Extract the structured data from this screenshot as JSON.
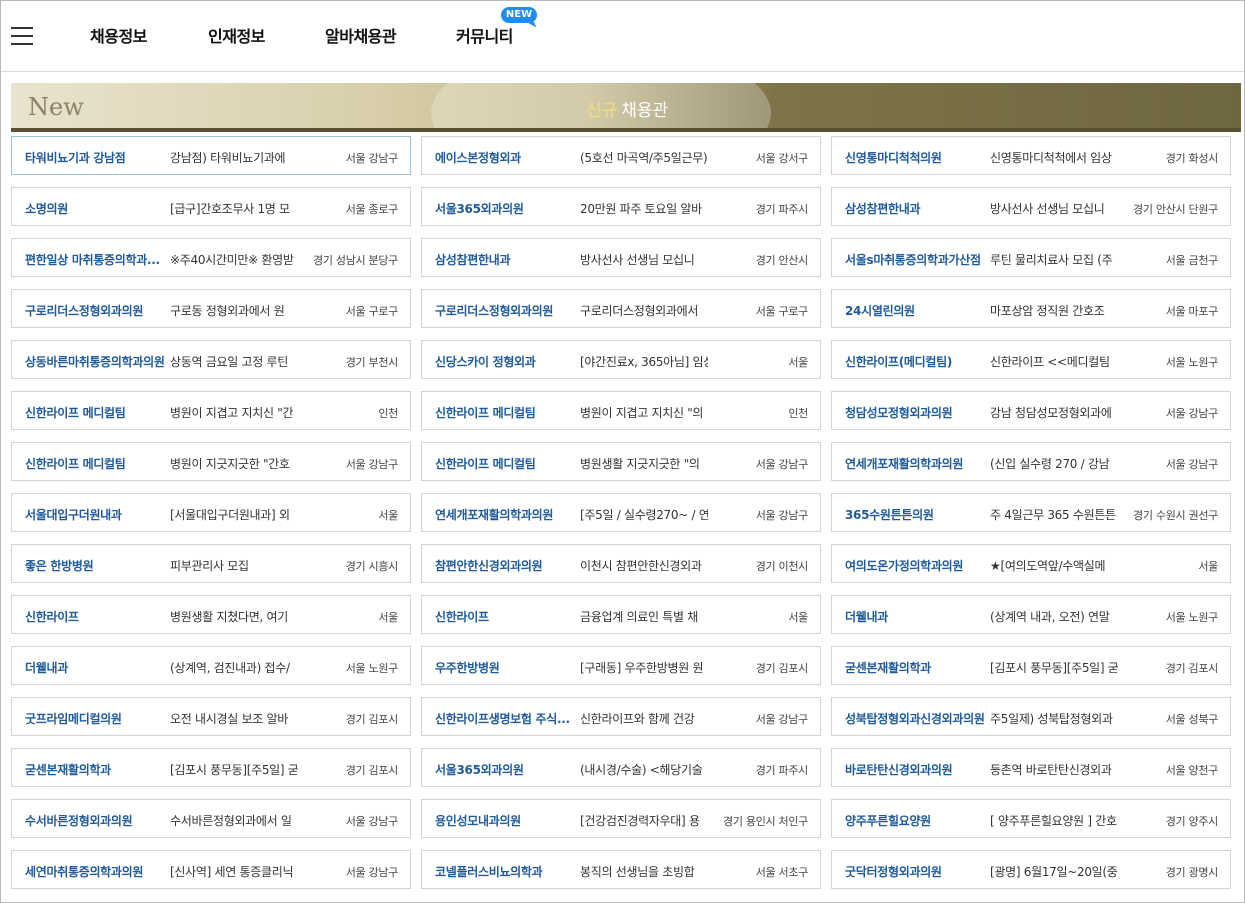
{
  "nav": {
    "items": [
      "채용정보",
      "인재정보",
      "알바채용관",
      "커뮤니티"
    ],
    "badge": "NEW"
  },
  "banner": {
    "new_label": "New",
    "highlight": "신규",
    "title": "채용관"
  },
  "jobs": [
    [
      {
        "name": "타워비뇨기과 강남점",
        "desc": "강남점) 타워비뇨기과에",
        "loc": "서울 강남구"
      },
      {
        "name": "에이스본정형외과",
        "desc": "(5호선 마곡역/주5일근무)",
        "loc": "서울 강서구"
      },
      {
        "name": "신영통마디척척의원",
        "desc": "신영통마디척척에서 임상",
        "loc": "경기 화성시"
      }
    ],
    [
      {
        "name": "소명의원",
        "desc": "[급구]간호조무사 1명 모",
        "loc": "서울 종로구"
      },
      {
        "name": "서울365외과의원",
        "desc": "20만원 파주 토요일 알바",
        "loc": "경기 파주시"
      },
      {
        "name": "삼성참편한내과",
        "desc": "방사선사 선생님 모십니",
        "loc": "경기 안산시 단원구"
      }
    ],
    [
      {
        "name": "편한일상 마취통증의학과...",
        "desc": "※주40시간미만※ 환영받",
        "loc": "경기 성남시 분당구"
      },
      {
        "name": "삼성참편한내과",
        "desc": "방사선사 선생님 모십니",
        "loc": "경기 안산시"
      },
      {
        "name": "서울s마취통증의학과가산점",
        "desc": "루틴 물리치료사 모집 (주",
        "loc": "서울 금천구"
      }
    ],
    [
      {
        "name": "구로리더스정형외과의원",
        "desc": "구로동 정형외과에서 원",
        "loc": "서울 구로구"
      },
      {
        "name": "구로리더스정형외과의원",
        "desc": "구로리더스정형외과에서",
        "loc": "서울 구로구"
      },
      {
        "name": "24시열린의원",
        "desc": "마포상암 정직원 간호조",
        "loc": "서울 마포구"
      }
    ],
    [
      {
        "name": "상동바른마취통증의학과의원",
        "desc": "상동역 금요일 고정 루틴",
        "loc": "경기 부천시"
      },
      {
        "name": "신당스카이 정형외과",
        "desc": "[야간진료x, 365아님] 임상",
        "loc": "서울"
      },
      {
        "name": "신한라이프(메디컬팀)",
        "desc": "신한라이프 <<메디컬팀",
        "loc": "서울 노원구"
      }
    ],
    [
      {
        "name": "신한라이프 메디컬팀",
        "desc": "병원이 지겹고 지치신 \"간",
        "loc": "인천"
      },
      {
        "name": "신한라이프 메디컬팀",
        "desc": "병원이 지겹고 지치신 \"의",
        "loc": "인천"
      },
      {
        "name": "청담성모정형외과의원",
        "desc": "강남 청담성모정형외과에",
        "loc": "서울 강남구"
      }
    ],
    [
      {
        "name": "신한라이프 메디컬팀",
        "desc": "병원이 지긋지긋한 \"간호",
        "loc": "서울 강남구"
      },
      {
        "name": "신한라이프 메디컬팀",
        "desc": "병원생활 지긋지긋한 \"의",
        "loc": "서울 강남구"
      },
      {
        "name": "연세개포재활의학과의원",
        "desc": "(신입 실수령 270 / 강남",
        "loc": "서울 강남구"
      }
    ],
    [
      {
        "name": "서울대입구더원내과",
        "desc": "[서울대입구더원내과] 외",
        "loc": "서울"
      },
      {
        "name": "연세개포재활의학과의원",
        "desc": "[주5일 / 실수령270~ / 연",
        "loc": "서울 강남구"
      },
      {
        "name": "365수원튼튼의원",
        "desc": "주 4일근무 365 수원튼튼",
        "loc": "경기 수원시 권선구"
      }
    ],
    [
      {
        "name": "좋은 한방병원",
        "desc": "피부관리사 모집",
        "loc": "경기 시흥시"
      },
      {
        "name": "참편안한신경외과의원",
        "desc": "이천시 참편안한신경외과",
        "loc": "경기 이천시"
      },
      {
        "name": "여의도온가정의학과의원",
        "desc": "★[여의도역앞/수액실메",
        "loc": "서울"
      }
    ],
    [
      {
        "name": "신한라이프",
        "desc": "병원생활 지쳤다면, 여기",
        "loc": "서울"
      },
      {
        "name": "신한라이프",
        "desc": "금융업계 의료인 특별 채",
        "loc": "서울"
      },
      {
        "name": "더웰내과",
        "desc": "(상계역 내과, 오전) 연말",
        "loc": "서울 노원구"
      }
    ],
    [
      {
        "name": "더웰내과",
        "desc": "(상계역, 검진내과) 접수/",
        "loc": "서울 노원구"
      },
      {
        "name": "우주한방병원",
        "desc": "[구래동] 우주한방병원 원",
        "loc": "경기 김포시"
      },
      {
        "name": "굳센본재활의학과",
        "desc": "[김포시 풍무동][주5일] 굳",
        "loc": "경기 김포시"
      }
    ],
    [
      {
        "name": "굿프라임메디컬의원",
        "desc": "오전 내시경실 보조 알바",
        "loc": "경기 김포시"
      },
      {
        "name": "신한라이프생명보험 주식...",
        "desc": "신한라이프와 함께 건강",
        "loc": "서울 강남구"
      },
      {
        "name": "성북탑정형외과신경외과의원",
        "desc": "주5일제) 성북탑정형외과",
        "loc": "서울 성북구"
      }
    ],
    [
      {
        "name": "굳센본재활의학과",
        "desc": "[김포시 풍무동][주5일] 굳",
        "loc": "경기 김포시"
      },
      {
        "name": "서울365외과의원",
        "desc": "(내시경/수술) <해당기술",
        "loc": "경기 파주시"
      },
      {
        "name": "바로탄탄신경외과의원",
        "desc": "등촌역 바로탄탄신경외과",
        "loc": "서울 양천구"
      }
    ],
    [
      {
        "name": "수서바른정형외과의원",
        "desc": "수서바른정형외과에서 일",
        "loc": "서울 강남구"
      },
      {
        "name": "용인성모내과의원",
        "desc": "[건강검진경력자우대] 용",
        "loc": "경기 용인시 처인구"
      },
      {
        "name": "양주푸른힐요양원",
        "desc": "[ 양주푸른힐요양원 ] 간호",
        "loc": "경기 양주시"
      }
    ],
    [
      {
        "name": "세연마취통증의학과의원",
        "desc": "[신사역] 세연 통증클리닉",
        "loc": "서울 강남구"
      },
      {
        "name": "코넬플러스비뇨의학과",
        "desc": "봉직의 선생님을 초빙합",
        "loc": "서울 서초구"
      },
      {
        "name": "굿닥터정형외과의원",
        "desc": "[광명] 6월17일~20일(중 4",
        "loc": "경기 광명시"
      }
    ]
  ]
}
